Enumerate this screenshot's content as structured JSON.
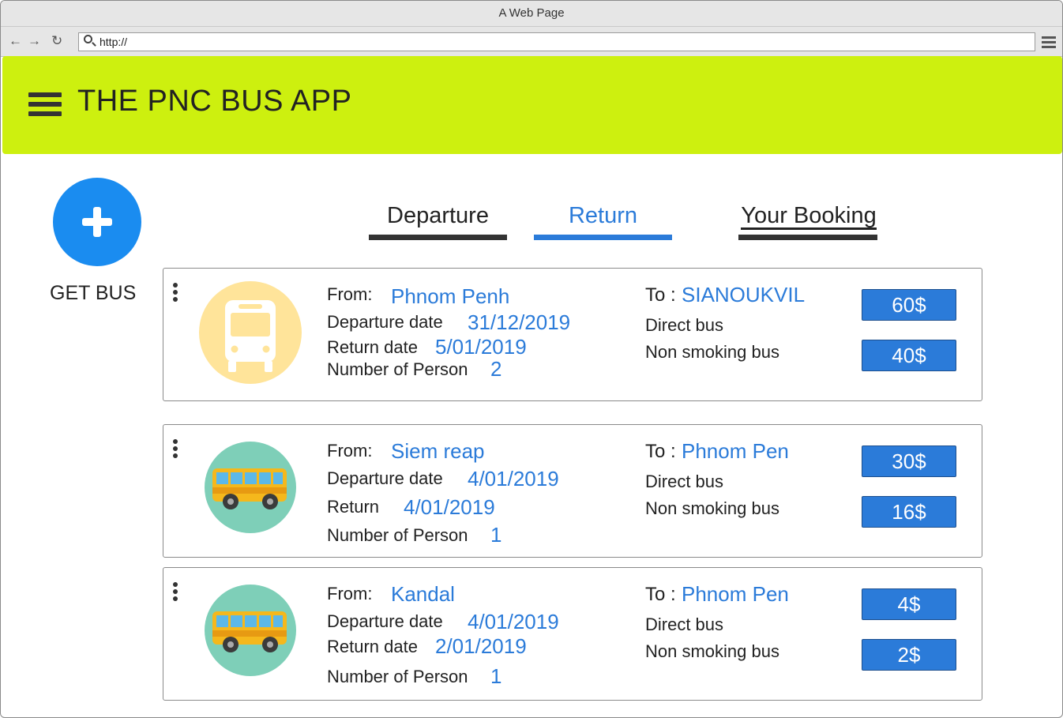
{
  "browser": {
    "window_title": "A Web Page",
    "url": "http://"
  },
  "app": {
    "title": "THE PNC BUS APP",
    "get_bus_label": "GET BUS"
  },
  "tabs": [
    {
      "label": "Departure",
      "active": false
    },
    {
      "label": "Return",
      "active": true
    },
    {
      "label": "Your Booking",
      "active": false
    }
  ],
  "labels": {
    "from": "From:",
    "to": "To :",
    "departure_date": "Departure date",
    "return_date": "Return date",
    "return": "Return",
    "number_of_person": "Number of Person",
    "direct_bus": "Direct bus",
    "non_smoking_bus": "Non smoking bus"
  },
  "colors": {
    "appbar": "#cdf00f",
    "accent": "#2b7bd9",
    "fab": "#1a8cf0",
    "thumb_yellow": "#ffe49a",
    "thumb_teal": "#7ecfb8"
  },
  "trips": [
    {
      "from": "Phnom Penh",
      "to": "SIANOUKVIL",
      "departure_date": "31/12/2019",
      "return_label": "Return date",
      "return_date": "5/01/2019",
      "persons": "2",
      "direct_price": "60$",
      "non_smoking_price": "40$",
      "icon": "bus-front-icon"
    },
    {
      "from": "Siem reap",
      "to": "Phnom Pen",
      "departure_date": "4/01/2019",
      "return_label": "Return",
      "return_date": "4/01/2019",
      "persons": "1",
      "direct_price": "30$",
      "non_smoking_price": "16$",
      "icon": "bus-side-icon"
    },
    {
      "from": "Kandal",
      "to": "Phnom Pen",
      "departure_date": "4/01/2019",
      "return_label": "Return date",
      "return_date": "2/01/2019",
      "persons": "1",
      "direct_price": "4$",
      "non_smoking_price": "2$",
      "icon": "bus-side-icon"
    }
  ]
}
